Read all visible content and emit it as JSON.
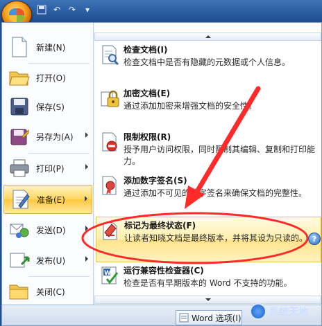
{
  "left_menu": [
    {
      "label": "新建(N)",
      "icon": "new-document-icon",
      "has_arrow": false,
      "active": false
    },
    {
      "label": "打开(O)",
      "icon": "folder-open-icon",
      "has_arrow": false,
      "active": false
    },
    {
      "label": "保存(S)",
      "icon": "save-disk-icon",
      "has_arrow": false,
      "active": false
    },
    {
      "label": "另存为(A)",
      "icon": "save-as-icon",
      "has_arrow": true,
      "active": false
    },
    {
      "label": "打印(P)",
      "icon": "printer-icon",
      "has_arrow": true,
      "active": false
    },
    {
      "label": "准备(E)",
      "icon": "prepare-icon",
      "has_arrow": true,
      "active": true
    },
    {
      "label": "发送(D)",
      "icon": "send-icon",
      "has_arrow": true,
      "active": false
    },
    {
      "label": "发布(U)",
      "icon": "publish-icon",
      "has_arrow": true,
      "active": false
    },
    {
      "label": "关闭(C)",
      "icon": "close-folder-icon",
      "has_arrow": false,
      "active": false
    }
  ],
  "prepare_menu": [
    {
      "title": "检查文档(I)",
      "desc": "检查文档中是否有隐藏的元数据或个人信息。",
      "icon": "inspect-document-icon",
      "highlight": false
    },
    {
      "title": "加密文档(E)",
      "desc": "通过添加加密来增强文档的安全性。",
      "icon": "encrypt-lock-icon",
      "highlight": false
    },
    {
      "title": "限制权限(R)",
      "desc": "授予用户访问权限，同时限制其编辑、复制和打印能力。",
      "icon": "restrict-permission-icon",
      "highlight": false
    },
    {
      "title": "添加数字签名(S)",
      "desc": "通过添加不可见的数字签名来确保文档的完整性。",
      "icon": "digital-signature-icon",
      "highlight": false
    },
    {
      "title": "标记为最终状态(F)",
      "desc": "让读者知晓文档是最终版本，并将其设为只读的。",
      "icon": "mark-final-icon",
      "highlight": true
    },
    {
      "title": "运行兼容性检查器(C)",
      "desc": "检查是否有早期版本的 Word 不支持的功能。",
      "icon": "compatibility-checker-icon",
      "highlight": false
    }
  ],
  "bottom": {
    "word_options": "Word 选项(I)",
    "watermark": "系统天地"
  },
  "colors": {
    "accent_annotation": "#ff2a2a",
    "highlight": "#ffe38a"
  }
}
